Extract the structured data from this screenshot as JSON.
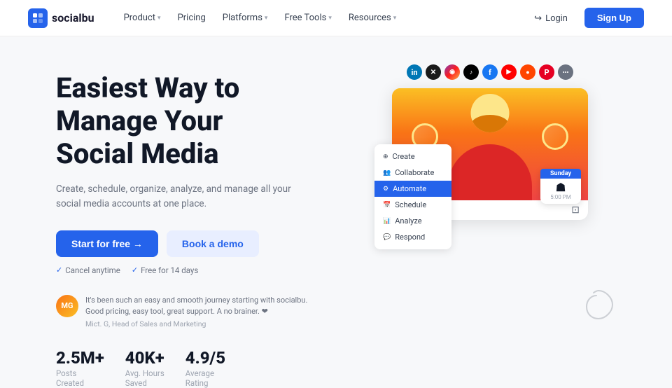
{
  "nav": {
    "logo_text": "socialbu",
    "links": [
      {
        "label": "Product",
        "has_dropdown": true
      },
      {
        "label": "Pricing",
        "has_dropdown": false
      },
      {
        "label": "Platforms",
        "has_dropdown": true
      },
      {
        "label": "Free Tools",
        "has_dropdown": true
      },
      {
        "label": "Resources",
        "has_dropdown": true
      }
    ],
    "login_label": "Login",
    "signup_label": "Sign Up"
  },
  "hero": {
    "title_line1": "Easiest Way to",
    "title_line2": "Manage Your",
    "title_line3": "Social Media",
    "subtitle": "Create, schedule, organize, analyze, and manage all your social media accounts at one place.",
    "start_btn": "Start for free  →",
    "demo_btn": "Book a demo",
    "trust1": "Cancel anytime",
    "trust2": "Free for 14 days"
  },
  "testimonial": {
    "text": "It's been such an easy and smooth journey starting with socialbu. Good pricing, easy tool, great support. A no brainer. ❤",
    "author": "Mict. G, Head of Sales and Marketing"
  },
  "stats": [
    {
      "value": "2.5M+",
      "label_line1": "Posts",
      "label_line2": "Created"
    },
    {
      "value": "40K+",
      "label_line1": "Avg. Hours",
      "label_line2": "Saved"
    },
    {
      "value": "4.9/5",
      "label_line1": "Average",
      "label_line2": "Rating"
    }
  ],
  "sidebar_menu": [
    {
      "label": "Create",
      "active": false
    },
    {
      "label": "Collaborate",
      "active": false
    },
    {
      "label": "Automate",
      "active": true
    },
    {
      "label": "Schedule",
      "active": false
    },
    {
      "label": "Analyze",
      "active": false
    },
    {
      "label": "Respond",
      "active": false
    }
  ],
  "schedule_badge": {
    "day": "Sunday",
    "time": "5:00 PM"
  },
  "social_platforms": [
    {
      "name": "LinkedIn",
      "class": "si-li",
      "symbol": "in"
    },
    {
      "name": "Twitter/X",
      "class": "si-tw",
      "symbol": "𝕏"
    },
    {
      "name": "Instagram",
      "class": "si-ig",
      "symbol": "◉"
    },
    {
      "name": "TikTok",
      "class": "si-tt",
      "symbol": "♪"
    },
    {
      "name": "Facebook",
      "class": "si-fb",
      "symbol": "f"
    },
    {
      "name": "YouTube",
      "class": "si-yt",
      "symbol": "▶"
    },
    {
      "name": "Reddit",
      "class": "si-rd",
      "symbol": "●"
    },
    {
      "name": "Pinterest",
      "class": "si-pi",
      "symbol": "P"
    },
    {
      "name": "More",
      "class": "si-more",
      "symbol": "..."
    }
  ]
}
